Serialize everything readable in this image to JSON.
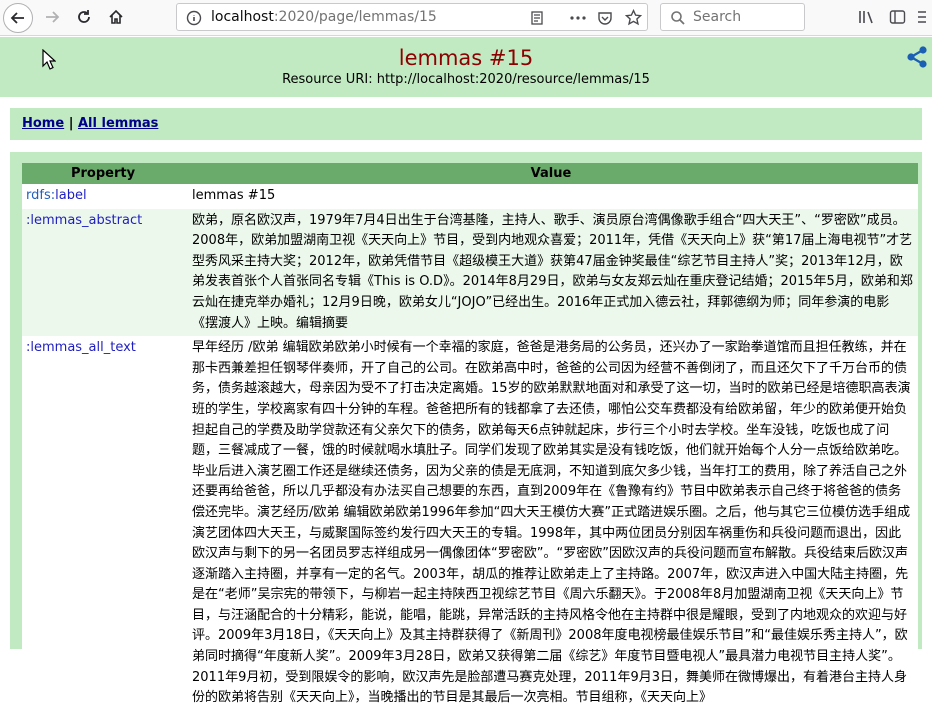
{
  "browser": {
    "url_host": "localhost",
    "url_path": ":2020/page/lemmas/15",
    "search_placeholder": "Search"
  },
  "page": {
    "title": "lemmas #15",
    "resource_uri": "Resource URI: http://localhost:2020/resource/lemmas/15"
  },
  "nav": {
    "home": "Home",
    "separator": " | ",
    "all": "All lemmas"
  },
  "table": {
    "headers": [
      "Property",
      "Value"
    ],
    "rows": [
      {
        "prefix": "rdfs:",
        "name": "label",
        "value": "lemmas #15"
      },
      {
        "prefix": "",
        "name": ":lemmas_abstract",
        "value": "欧弟，原名欧汉声，1979年7月4日出生于台湾基隆，主持人、歌手、演员原台湾偶像歌手组合“四大天王”、“罗密欧”成员。2008年，欧弟加盟湖南卫视《天天向上》节目，受到内地观众喜爱；2011年，凭借《天天向上》获“第17届上海电视节”才艺型秀风采主持大奖；2012年，欧弟凭借节目《超级模王大道》获第47届金钟奖最佳“综艺节目主持人”奖；2013年12月，欧弟发表首张个人首张同名专辑《This is O.D》。2014年8月29日，欧弟与女友郑云灿在重庆登记结婚；2015年5月，欧弟和郑云灿在捷克举办婚礼；12月9日晚，欧弟女儿“JOJO”已经出生。2016年正式加入德云社，拜郭德纲为师；同年参演的电影《摆渡人》上映。编辑摘要"
      },
      {
        "prefix": "",
        "name": ":lemmas_all_text",
        "value": "早年经历 /欧弟 编辑欧弟欧弟小时候有一个幸福的家庭，爸爸是港务局的公务员，还兴办了一家跆拳道馆而且担任教练，并在那卡西兼差担任钢琴伴奏师，开了自己的公司。在欧弟高中时，爸爸的公司因为经营不善倒闭了，而且还欠下了千万台币的债务，债务越滚越大，母亲因为受不了打击决定离婚。15岁的欧弟默默地面对和承受了这一切，当时的欧弟已经是培德职高表演班的学生，学校离家有四十分钟的车程。爸爸把所有的钱都拿了去还债，哪怕公交车费都没有给欧弟留，年少的欧弟便开始负担起自己的学费及助学贷款还有父亲欠下的债务，欧弟每天6点钟就起床，步行三个小时去学校。坐车没钱，吃饭也成了问题，三餐减成了一餐，饿的时候就喝水填肚子。同学们发现了欧弟其实是没有钱吃饭，他们就开始每个人分一点饭给欧弟吃。毕业后进入演艺圈工作还是继续还债务，因为父亲的债是无底洞，不知道到底欠多少钱，当年打工的费用，除了养活自己之外还要再给爸爸，所以几乎都没有办法买自己想要的东西，直到2009年在《鲁豫有约》节目中欧弟表示自己终于将爸爸的债务偿还完毕。演艺经历/欧弟 编辑欧弟欧弟1996年参加“四大天王模仿大赛”正式踏进娱乐圈。之后，他与其它三位模仿选手组成演艺团体四大天王，与威聚国际签约发行四大天王的专辑。1998年，其中两位团员分别因车祸重伤和兵役问题而退出，因此欧汉声与剩下的另一名团员罗志祥组成另一偶像团体“罗密欧”。“罗密欧”因欧汉声的兵役问题而宣布解散。兵役结束后欧汉声逐渐踏入主持圈，并享有一定的名气。2003年，胡瓜的推荐让欧弟走上了主持路。2007年，欧汉声进入中国大陆主持圈，先是在“老师”吴宗宪的带领下，与柳岩一起主持陕西卫视综艺节目《周六乐翻天》。于2008年8月加盟湖南卫视《天天向上》节目，与汪涵配合的十分精彩，能说，能唱，能跳，异常活跃的主持风格令他在主持群中很是耀眼，受到了内地观众的欢迎与好评。2009年3月18日，《天天向上》及其主持群获得了《新周刊》2008年度电视榜最佳娱乐节目”和“最佳娱乐秀主持人”，欧弟同时摘得“年度新人奖”。2009年3月28日，欧弟又获得第二届《综艺》年度节目暨电视人”最具潜力电视节目主持人奖”。2011年9月初，受到限娱令的影响，欧汉声先是脸部遭马赛克处理，2011年9月3日，舞美师在微博爆出，有着港台主持人身份的欧弟将告别《天天向上》，当晚播出的节目是其最后一次亮相。节目组称，《天天向上》"
      }
    ]
  }
}
